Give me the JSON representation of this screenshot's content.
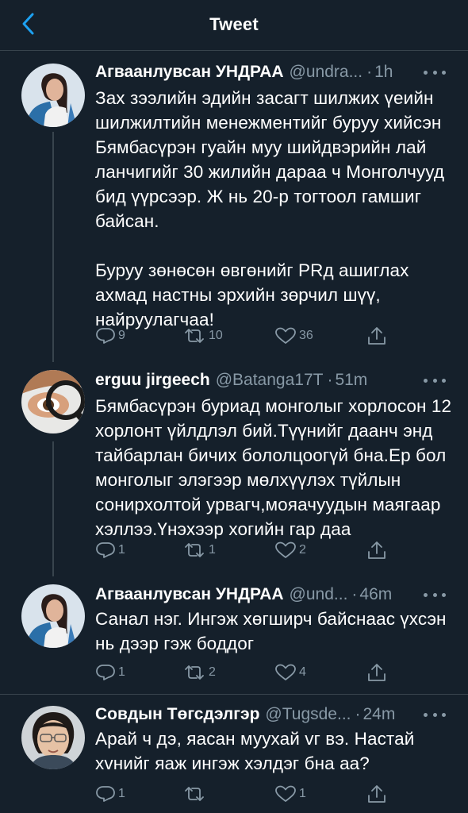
{
  "header": {
    "title": "Tweet",
    "back_icon": "chevron-left-icon"
  },
  "colors": {
    "background": "#15202b",
    "accent": "#1da1f2",
    "secondary_text": "#8899a6",
    "divider": "#38444d"
  },
  "tweets": [
    {
      "name": "Агваанлувсан УНДРАА",
      "handle": "@undra...",
      "time": "1h",
      "text": "Зах зээлийн эдийн засагт шилжих үеийн шилжилтийн менежментийг буруу хийсэн Бямбасүрэн гуайн муу шийдвэрийн лай ланчигийг 30 жилийн дараа ч Монголчууд бид үүрсээр. Ж нь 20-р тогтоол гамшиг байсан.\n\nБуруу зөнөсөн өвгөнийг PRд ашиглах ахмад настны эрхийн зөрчил шүү, найруулагчаа!",
      "replies": "9",
      "retweets": "10",
      "likes": "36"
    },
    {
      "name": "erguu jirgeech",
      "handle": "@Batanga17T",
      "time": "51m",
      "text": "Бямбасүрэн буриад монголыг хорлосон 12 хорлонт үйлдлэл бий.Түүнийг даанч энд тайбарлан бичих бололцоогүй бна.Ер бол монголыг элэгээр мөлхүүлэх түйлын сонирхолтой урвагч,мояачуудын маягаар хэллээ.Үнэхээр хогийн гар даа",
      "replies": "1",
      "retweets": "1",
      "likes": "2"
    },
    {
      "name": "Агваанлувсан УНДРАА",
      "handle": "@und...",
      "time": "46m",
      "text": "Санал нэг. Ингэж хөгширч байснаас үхсэн нь дээр гэж боддог",
      "replies": "1",
      "retweets": "2",
      "likes": "4"
    },
    {
      "name": "Совдын Төгсдэлгэр",
      "handle": "@Tugsde...",
      "time": "24m",
      "text": "Арай ч дэ, яасан муухай vг вэ. Настай хvнийг яаж ингэж хэлдэг бна аа?",
      "replies": "1",
      "retweets": "",
      "likes": "1"
    }
  ]
}
